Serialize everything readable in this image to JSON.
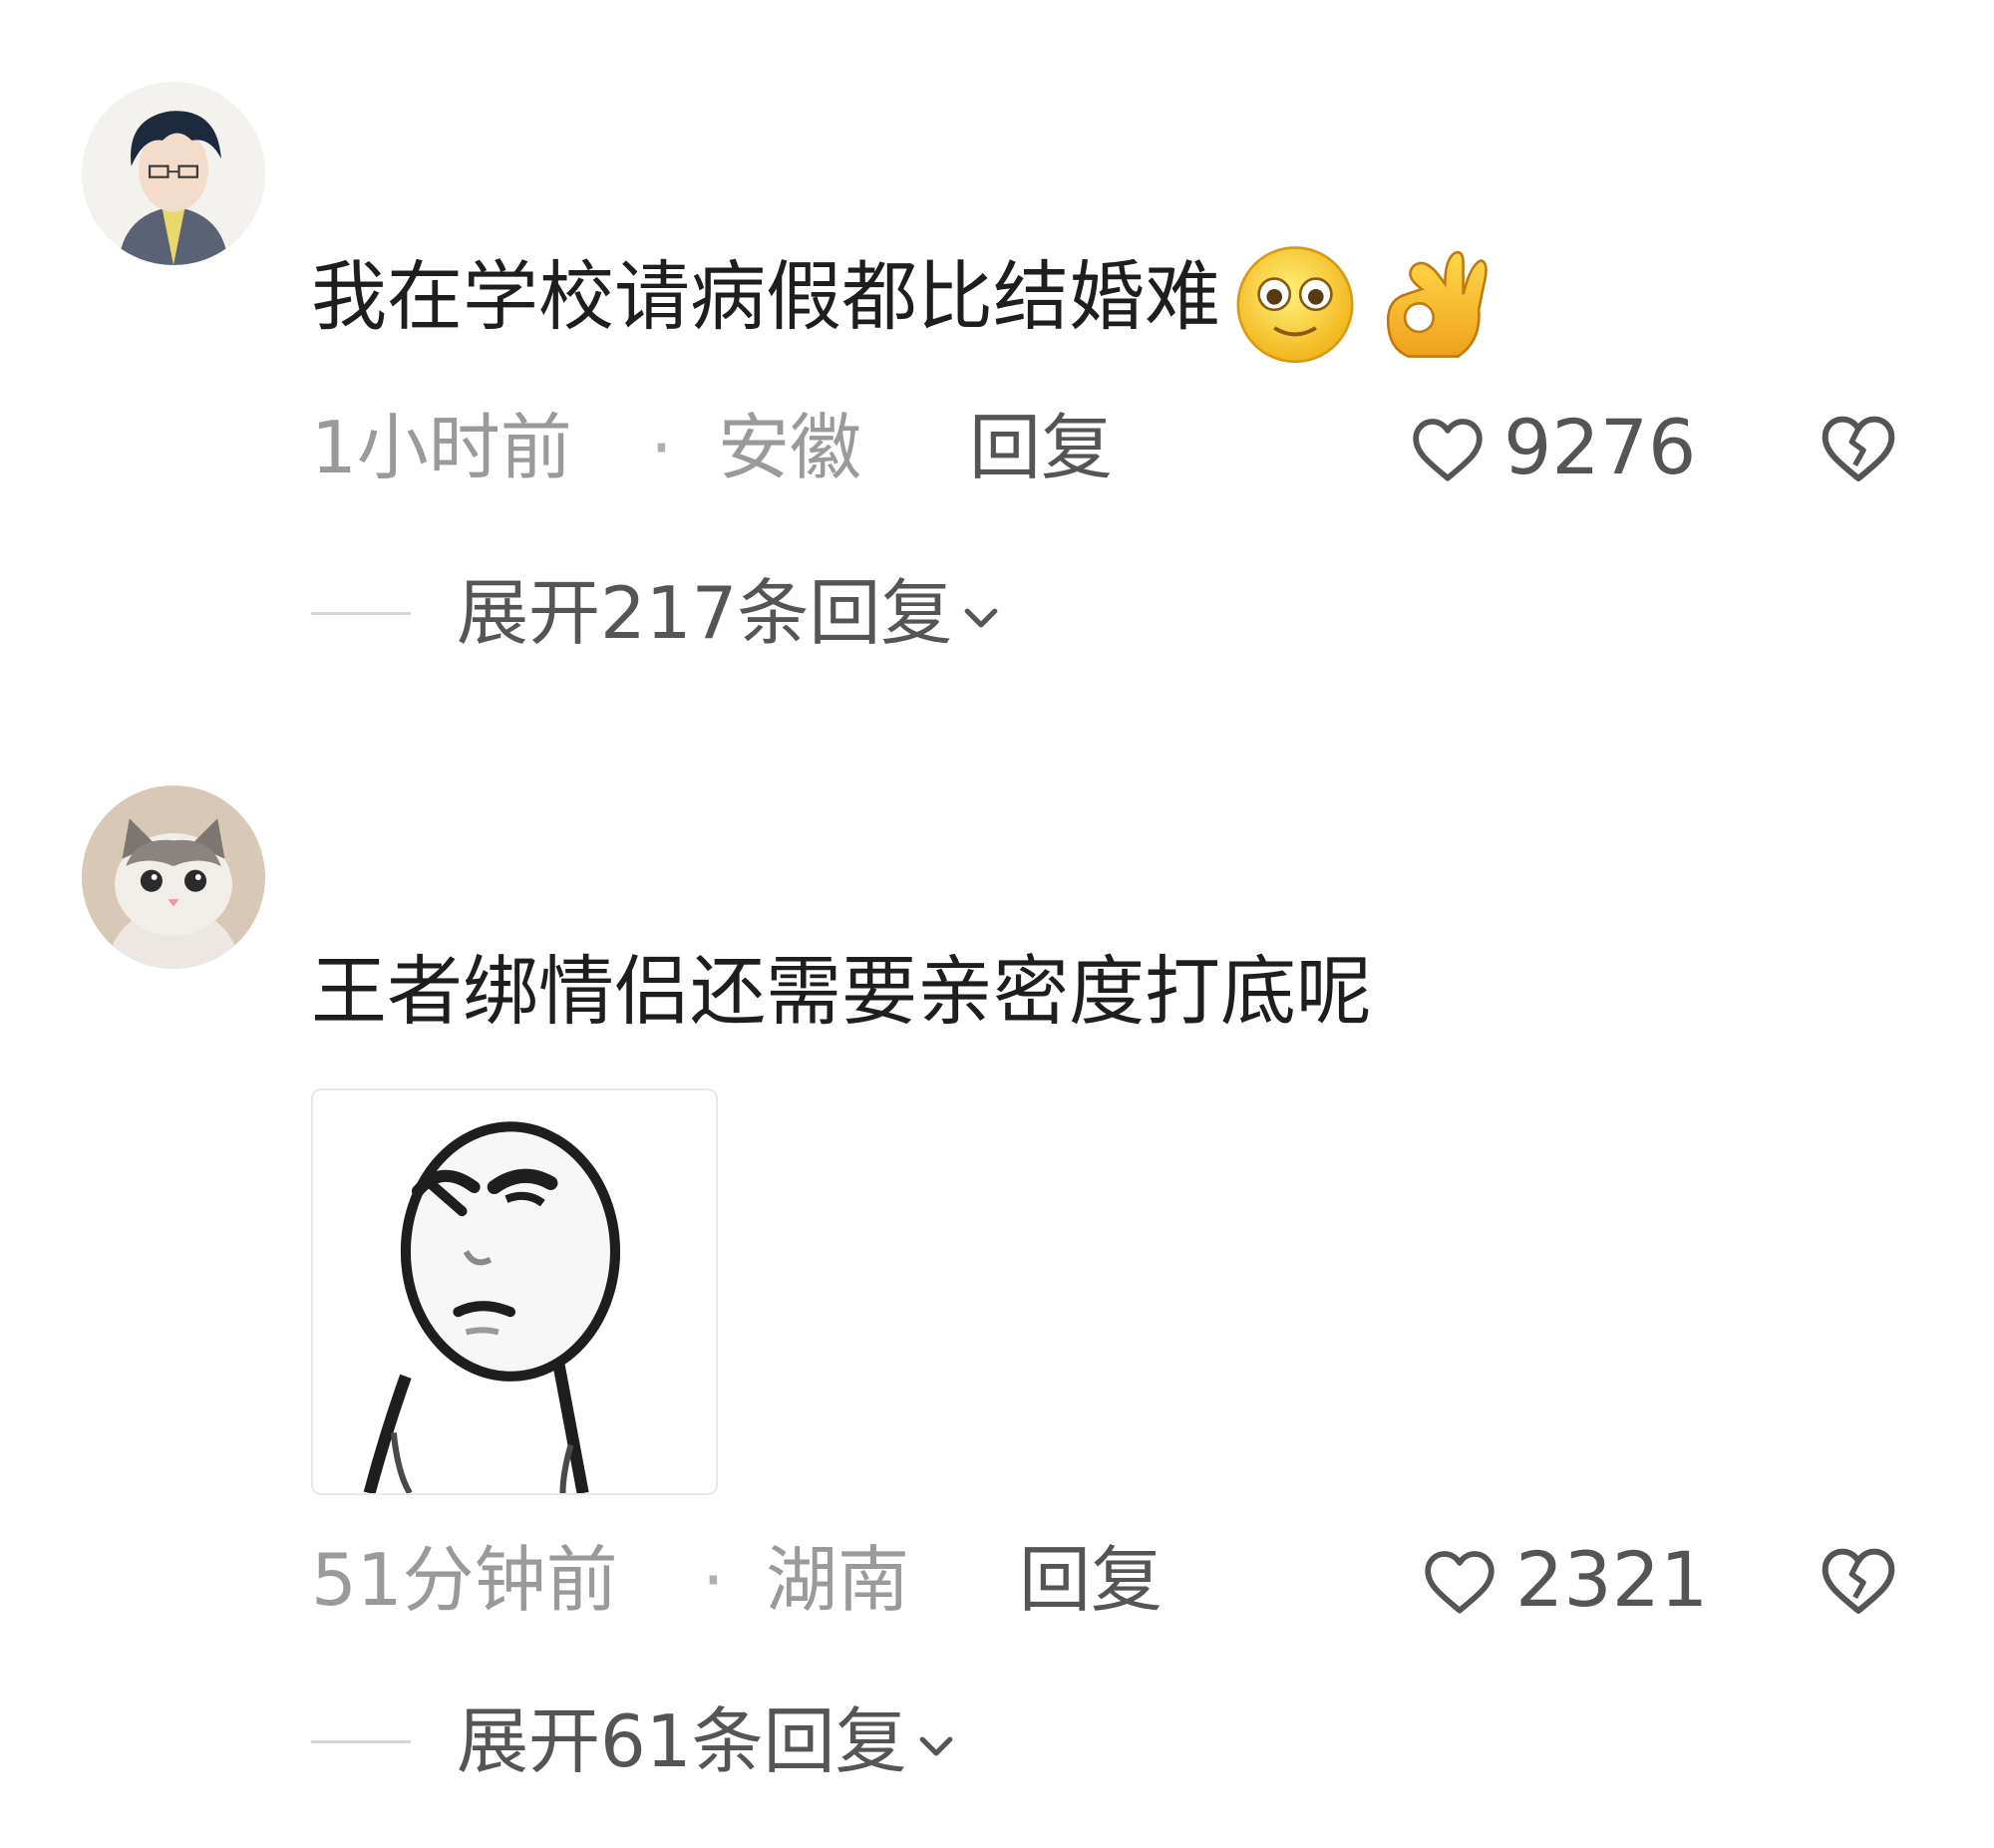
{
  "comments": [
    {
      "text": "我在学校请病假都比结婚难",
      "emojis": [
        "smile-face-emoji",
        "ok-hand-emoji"
      ],
      "time": "1小时前",
      "separator": "·",
      "location": "安徽",
      "reply_label": "回复",
      "like_count": "9276",
      "expand_label": "展开217条回复",
      "avatar": "anime-boy-avatar"
    },
    {
      "text": "王者绑情侣还需要亲密度打底呢",
      "sticker": "thinking-face-meme",
      "time": "51分钟前",
      "separator": "·",
      "location": "湖南",
      "reply_label": "回复",
      "like_count": "2321",
      "expand_label": "展开61条回复",
      "avatar": "cat-avatar"
    }
  ],
  "colors": {
    "text": "#1e1e1e",
    "meta": "#9a9a9a",
    "action": "#555555",
    "background": "#ffffff"
  }
}
